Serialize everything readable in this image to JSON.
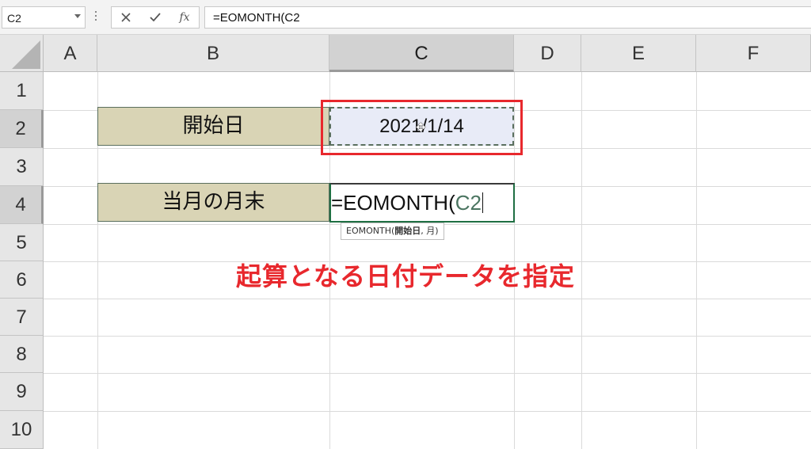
{
  "formula_bar": {
    "name_box": "C2",
    "cancel_icon": "close-x",
    "enter_icon": "checkmark",
    "fx_label": "fx",
    "formula": "=EOMONTH(C2"
  },
  "columns": [
    "A",
    "B",
    "C",
    "D",
    "E",
    "F"
  ],
  "rows": [
    "1",
    "2",
    "3",
    "4",
    "5",
    "6",
    "7",
    "8",
    "9",
    "10"
  ],
  "cells": {
    "B2": "開始日",
    "C2": "2021/1/14",
    "B4": "当月の月末",
    "C4_prefix": "=EOMONTH(",
    "C4_ref": "C2"
  },
  "tooltip": {
    "func": "EOMONTH(",
    "arg_bold": "開始日",
    "rest": ", 月)"
  },
  "annotation": "起算となる日付データを指定",
  "colors": {
    "highlight_red": "#e8282d",
    "label_fill": "#d9d4b5",
    "selected_fill": "#e8ebf7",
    "ref_color": "#4b7561"
  }
}
